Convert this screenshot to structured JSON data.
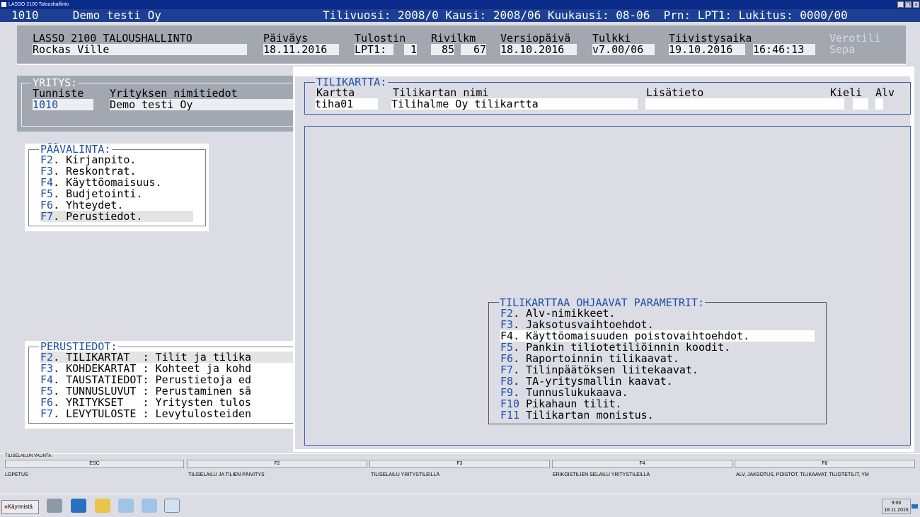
{
  "window": {
    "title": "LASSO 2100 Taloushallinto"
  },
  "statusbar": {
    "left": "1010     Demo testi Oy",
    "right": "Tilivuosi: 2008/0 Kausi: 2008/06 Kuukausi: 08-06  Prn: LPT1: Lukitus: 0000/00"
  },
  "header": {
    "app_name": "LASSO 2100 TALOUSHALLINTO",
    "user": "Rockas Ville",
    "paivays_label": "Päiväys",
    "paivays": "18.11.2016",
    "tulostin_label": "Tulostin",
    "tulostin": "LPT1:",
    "tulostin_num": "1",
    "rivilkm_label": "Rivilkm",
    "rivilkm_1": "85",
    "rivilkm_2": "67",
    "versiopaiva_label": "Versiopäivä",
    "versiopaiva": "18.10.2016",
    "tulkki_label": "Tulkki",
    "tulkki": "v7.00/06",
    "tiivistys_label": "Tiivistysaika",
    "tiivistys_date": "19.10.2016",
    "tiivistys_time": "16:46:13",
    "verotili": "Verotili",
    "sepa": "Sepa"
  },
  "yritys": {
    "title": "YRITYS:",
    "tunniste_label": "Tunniste",
    "nimi_label": "Yrityksen nimitiedot",
    "tunniste": "1010",
    "nimi": "Demo testi Oy"
  },
  "paavalinta": {
    "title": "PÄÄVALINTA:",
    "items": [
      {
        "key": "F2",
        "label": ". Kirjanpito."
      },
      {
        "key": "F3",
        "label": ". Reskontrat."
      },
      {
        "key": "F4",
        "label": ". Käyttöomaisuus."
      },
      {
        "key": "F5",
        "label": ". Budjetointi."
      },
      {
        "key": "F6",
        "label": ". Yhteydet."
      },
      {
        "key": "F7",
        "label": ". Perustiedot."
      }
    ]
  },
  "perustiedot": {
    "title": "PERUSTIEDOT:",
    "items": [
      {
        "key": "F2",
        "label": ". TILIKARTAT  : Tilit ja tilika"
      },
      {
        "key": "F3",
        "label": ". KOHDEKARTAT : Kohteet ja kohd"
      },
      {
        "key": "F4",
        "label": ". TAUSTATIEDOT: Perustietoja ed"
      },
      {
        "key": "F5",
        "label": ". TUNNUSLUVUT : Perustaminen sä"
      },
      {
        "key": "F6",
        "label": ". YRITYKSET   : Yritysten tulos"
      },
      {
        "key": "F7",
        "label": ". LEVYTULOSTE : Levytulosteiden"
      }
    ]
  },
  "tilikartta": {
    "title": "TILIKARTTA:",
    "kartta_label": "Kartta",
    "nimi_label": "Tilikartan nimi",
    "lisatieto_label": "Lisätieto",
    "kieli_label": "Kieli",
    "alv_label": "Alv",
    "kartta": "tiha01",
    "nimi": "Tilihalme Oy tilikartta",
    "lisatieto": ""
  },
  "parametrit": {
    "title": "TILIKARTTAA OHJAAVAT PARAMETRIT:",
    "items": [
      {
        "key": "F2",
        "label": ". Alv-nimikkeet."
      },
      {
        "key": "F3",
        "label": ". Jaksotusvaihtoehdot."
      },
      {
        "key": "F4",
        "label": ". Käyttöomaisuuden poistovaihtoehdot."
      },
      {
        "key": "F5",
        "label": ". Pankin tiliotetiliöinnin koodit."
      },
      {
        "key": "F6",
        "label": ". Raportoinnin tilikaavat."
      },
      {
        "key": "F7",
        "label": ". Tilinpäätöksen liitekaavat."
      },
      {
        "key": "F8",
        "label": ". TA-yritysmallin kaavat."
      },
      {
        "key": "F9",
        "label": ". Tunnuslukukaava."
      },
      {
        "key": "F10",
        "label": " Pikahaun tilit."
      },
      {
        "key": "F11",
        "label": " Tilikartan monistus."
      }
    ]
  },
  "fkeys": {
    "title": "TILISELAILUN VALINTA:",
    "items": [
      {
        "key": "ESC",
        "desc": "LOPETUS"
      },
      {
        "key": "F2",
        "desc": "TILISELAILU JA TILIEN PÄIVITYS"
      },
      {
        "key": "F3",
        "desc": "TILISELAILU YRITYSTILEILLÄ"
      },
      {
        "key": "F4",
        "desc": "ERIKOISTILIEN SELAILU YRITYSTILEILLÄ"
      },
      {
        "key": "F8",
        "desc": "ALV, JAKSOTUS, POISTOT, TILIKAAVAT, TILIOTETILIT, YM"
      }
    ]
  },
  "taskbar": {
    "start": "Käynnistä",
    "time": "9:06",
    "date": "18.11.2016"
  },
  "colors": {
    "statusbar": "#1d3f93",
    "fkey_text": "#1f4fa8",
    "panel": "#a3a8b0",
    "background": "#dcdce4"
  }
}
